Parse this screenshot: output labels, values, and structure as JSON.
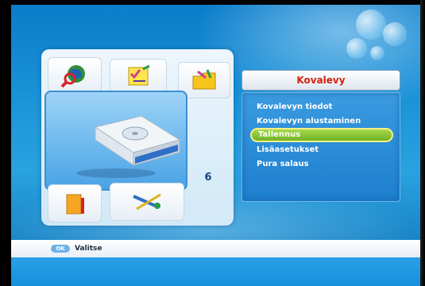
{
  "menu": {
    "title": "Kovalevy",
    "items": [
      {
        "label": "Kovalevyn tiedot",
        "selected": false
      },
      {
        "label": "Kovalevyn alustaminen",
        "selected": false
      },
      {
        "label": "Tallennus",
        "selected": true
      },
      {
        "label": "Lisäasetukset",
        "selected": false
      },
      {
        "label": "Pura salaus",
        "selected": false
      }
    ]
  },
  "icon_grid": {
    "page_number": "6",
    "icons": [
      "globe-search-icon",
      "checklist-icon",
      "folder-icon",
      "package-icon",
      "tools-icon"
    ],
    "selected_icon": "hard-disk-icon"
  },
  "footer": {
    "ok_key": "OK",
    "ok_label": "Valitse"
  },
  "colors": {
    "background": "#1b93d8",
    "title_text": "#d4220e",
    "selection": "#8cc63a",
    "selection_border": "#f5f08a"
  }
}
